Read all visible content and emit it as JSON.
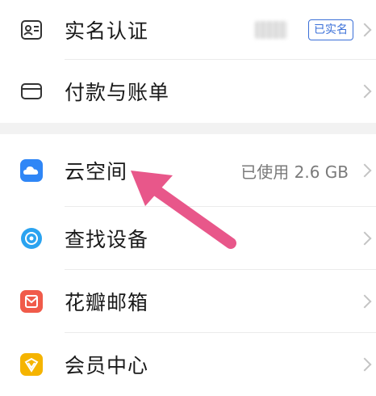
{
  "settings": {
    "group1": [
      {
        "label": "实名认证",
        "badge": "已实名",
        "icon": "id-card-icon"
      },
      {
        "label": "付款与账单",
        "icon": "card-icon"
      }
    ],
    "group2": [
      {
        "label": "云空间",
        "value": "已使用 2.6 GB",
        "icon": "cloud-icon"
      },
      {
        "label": "查找设备",
        "icon": "find-device-icon"
      },
      {
        "label": "花瓣邮箱",
        "icon": "mail-icon"
      },
      {
        "label": "会员中心",
        "icon": "member-icon"
      }
    ]
  },
  "colors": {
    "accent_blue": "#3a6fd8",
    "cloud_blue": "#2f86f6",
    "find_device_blue": "#2aa3f0",
    "mail_red": "#f05b4a",
    "member_yellow": "#f5b400",
    "arrow_pink": "#e8578a"
  }
}
